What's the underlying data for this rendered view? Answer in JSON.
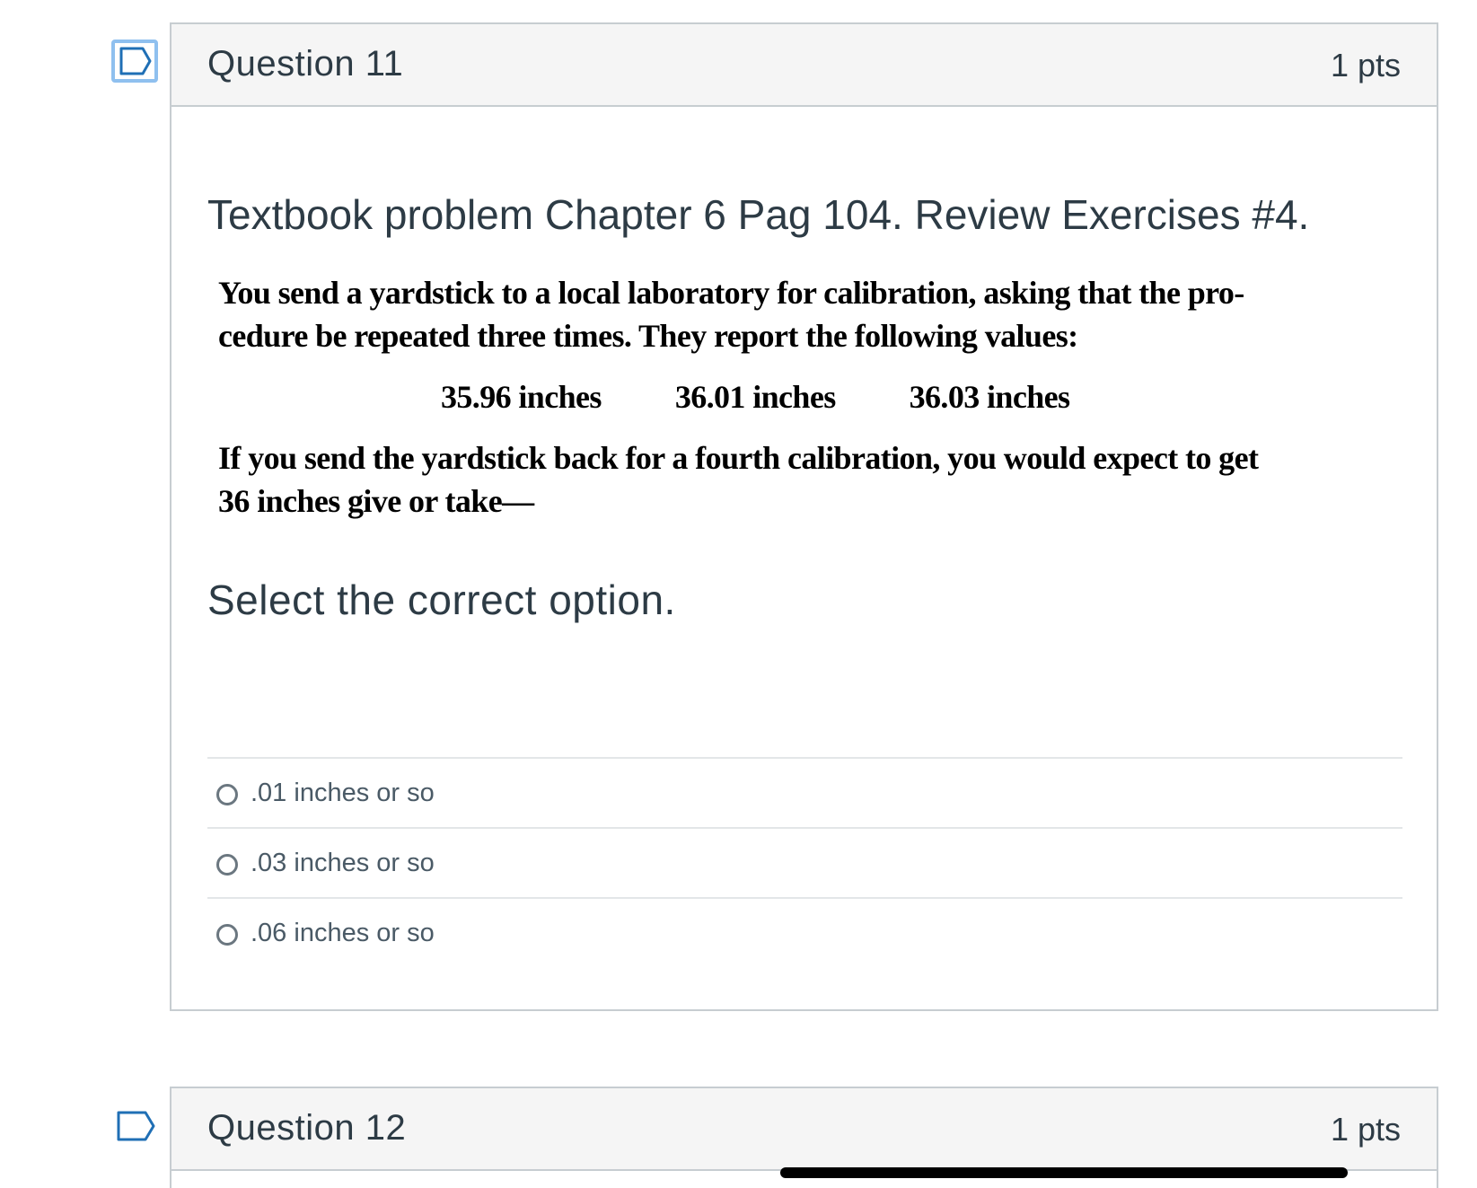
{
  "questions": [
    {
      "title": "Question 11",
      "points": "1 pts",
      "intro": "Textbook problem Chapter 6 Pag 104. Review Exercises #4.",
      "scanned_text": {
        "line1": "You send a yardstick to a local laboratory for calibration, asking that the pro-",
        "line2": "cedure be repeated three times. They report the following values:",
        "values": [
          "35.96 inches",
          "36.01 inches",
          "36.03 inches"
        ],
        "line3": "If you send the yardstick back for a fourth calibration, you would expect to get",
        "line4": "36 inches give or take—"
      },
      "prompt": "Select the correct option.",
      "options": [
        ".01 inches or so",
        ".03 inches or so",
        ".06 inches or so"
      ]
    },
    {
      "title": "Question 12",
      "points": "1 pts"
    }
  ],
  "icons": {
    "flag": "flag-question-icon",
    "radio": "radio-button-icon"
  },
  "colors": {
    "header_bg": "#f5f5f5",
    "border": "#c7cdd1",
    "text": "#2d3b45",
    "flag_focus": "#8fc0ef",
    "flag_stroke": "#1f6fb5"
  }
}
